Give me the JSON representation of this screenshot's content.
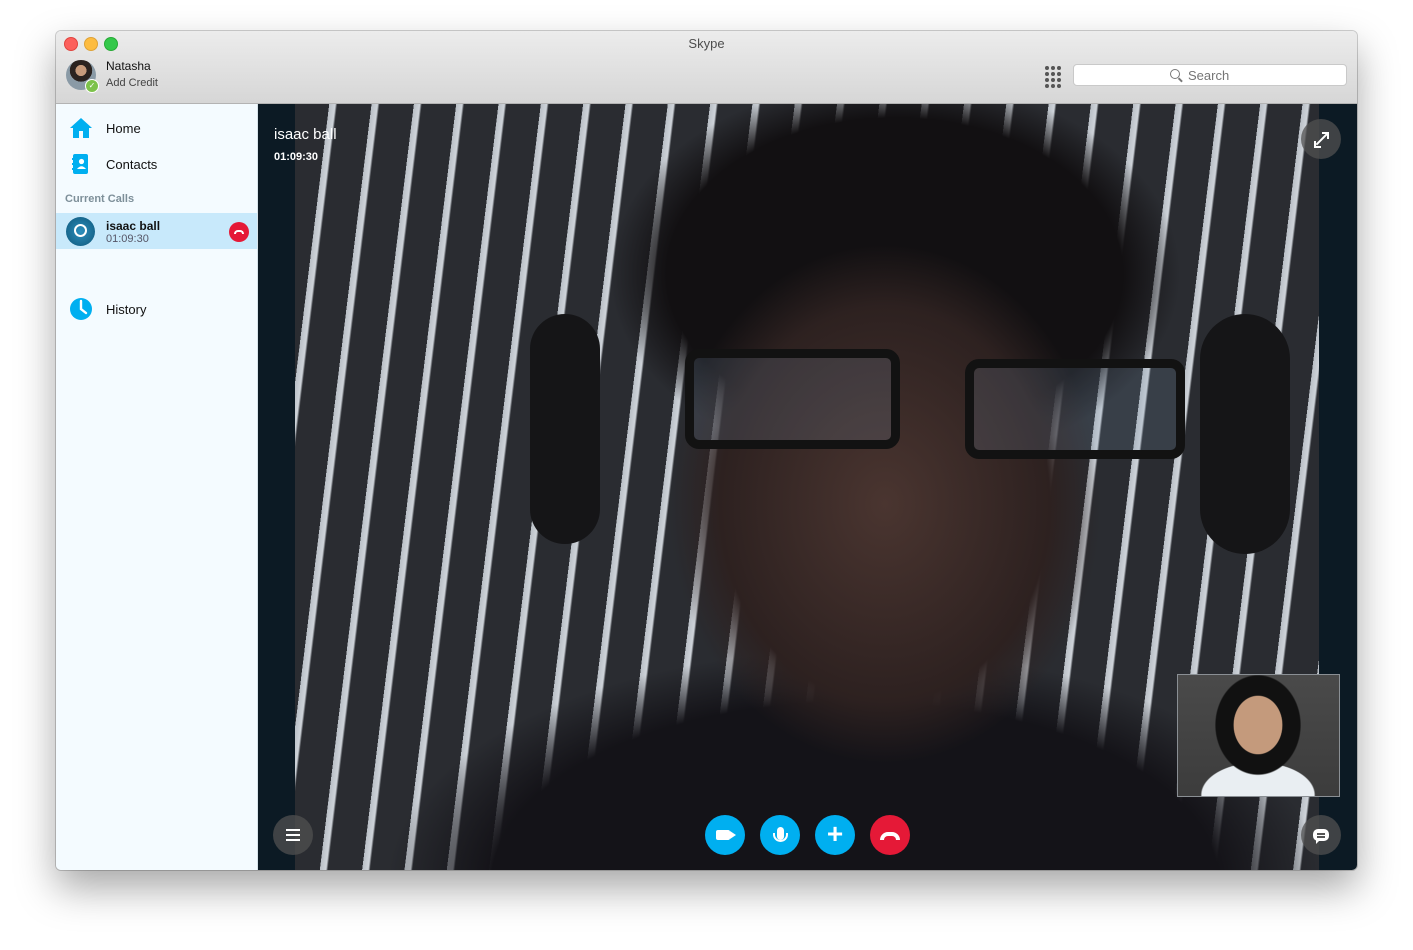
{
  "window": {
    "title": "Skype"
  },
  "account": {
    "name": "Natasha",
    "credit_label": "Add Credit",
    "status": "online"
  },
  "search": {
    "placeholder": "Search"
  },
  "sidebar": {
    "items": [
      {
        "label": "Home",
        "icon": "home-icon"
      },
      {
        "label": "Contacts",
        "icon": "contacts-icon"
      },
      {
        "label": "History",
        "icon": "clock-icon"
      }
    ],
    "section_label": "Current Calls",
    "current_call": {
      "name": "isaac ball",
      "duration": "01:09:30"
    }
  },
  "call": {
    "remote_name": "isaac ball",
    "timer": "01:09:30",
    "controls": [
      "video-icon",
      "microphone-icon",
      "plus-icon",
      "hang-up-icon"
    ]
  },
  "colors": {
    "accent": "#00aff0",
    "hangup": "#e51937",
    "selected_row": "#c8e9fb",
    "sidebar_bg": "#f4fbff",
    "presence": "#7dc24b"
  }
}
